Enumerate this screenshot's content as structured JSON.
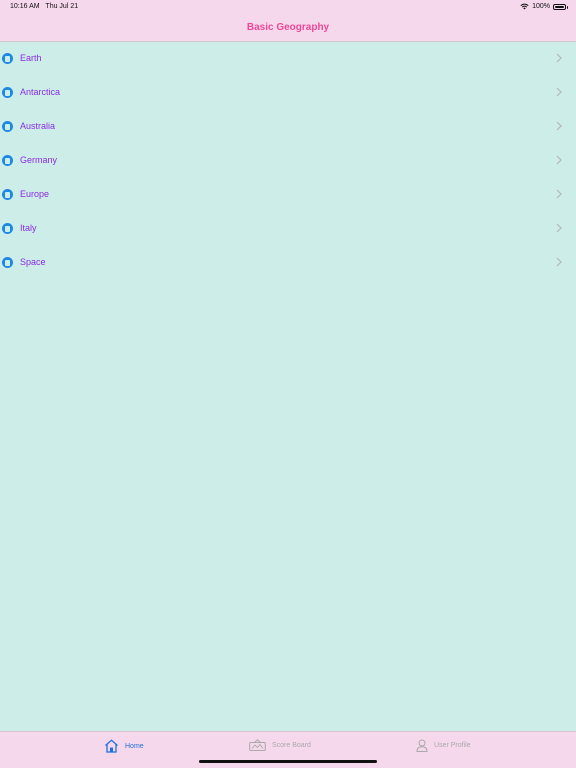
{
  "status": {
    "time": "10:16 AM",
    "date": "Thu Jul 21",
    "battery": "100%"
  },
  "nav": {
    "title": "Basic Geography"
  },
  "list": {
    "items": [
      {
        "label": "Earth",
        "icon": "book-icon"
      },
      {
        "label": "Antarctica",
        "icon": "book-icon"
      },
      {
        "label": "Australia",
        "icon": "book-icon"
      },
      {
        "label": "Germany",
        "icon": "book-icon"
      },
      {
        "label": "Europe",
        "icon": "book-icon"
      },
      {
        "label": "Italy",
        "icon": "book-icon"
      },
      {
        "label": "Space",
        "icon": "book-icon"
      }
    ]
  },
  "tabs": [
    {
      "label": "Home",
      "icon": "home-icon",
      "active": true
    },
    {
      "label": "Score Board",
      "icon": "scoreboard-icon",
      "active": false
    },
    {
      "label": "User Profile",
      "icon": "user-icon",
      "active": false
    }
  ],
  "colors": {
    "background": "#cdeee8",
    "bars": "#f6d8ec",
    "title": "#ec4899",
    "item_text": "#8a2be2",
    "active_tab": "#1e6fe0"
  }
}
